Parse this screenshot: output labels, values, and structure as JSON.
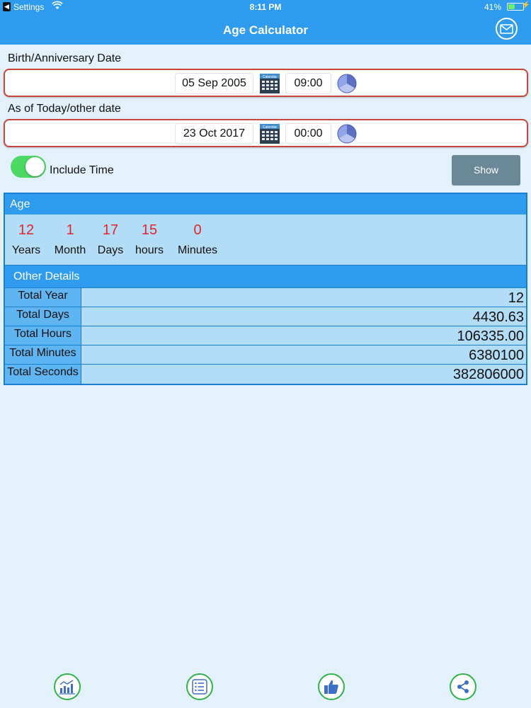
{
  "status_bar": {
    "carrier": "Settings",
    "time": "8:11 PM",
    "battery": "41%"
  },
  "nav": {
    "title": "Age Calculator"
  },
  "birth": {
    "label": "Birth/Anniversary Date",
    "date": "05 Sep 2005",
    "time": "09:00"
  },
  "asof": {
    "label": "As of Today/other date",
    "date": "23 Oct 2017",
    "time": "00:00"
  },
  "options": {
    "include_time_label": "Include Time",
    "include_time_on": true,
    "show_label": "Show"
  },
  "age": {
    "title": "Age",
    "parts": [
      {
        "value": "12",
        "unit": "Years"
      },
      {
        "value": "1",
        "unit": "Month"
      },
      {
        "value": "17",
        "unit": "Days"
      },
      {
        "value": "15",
        "unit": "hours"
      },
      {
        "value": "0",
        "unit": "Minutes"
      }
    ]
  },
  "details": {
    "title": "Other Details",
    "rows": [
      {
        "label": "Total Year",
        "value": "12"
      },
      {
        "label": "Total Days",
        "value": "4430.63"
      },
      {
        "label": "Total Hours",
        "value": "106335.00"
      },
      {
        "label": "Total Minutes",
        "value": "6380100"
      },
      {
        "label": "Total Seconds",
        "value": "382806000"
      }
    ]
  },
  "icons": {
    "mail": "mail-icon",
    "calendar": "calendar-icon",
    "clock": "clock-icon",
    "chart": "chart-icon",
    "list": "list-icon",
    "like": "thumbs-up-icon",
    "share": "share-icon"
  },
  "colors": {
    "accent": "#2f9cf0",
    "age_number": "#e5232a",
    "toggle_on": "#4cd964",
    "date_border": "#c8463c",
    "bottom_ring": "#2fb34a"
  }
}
